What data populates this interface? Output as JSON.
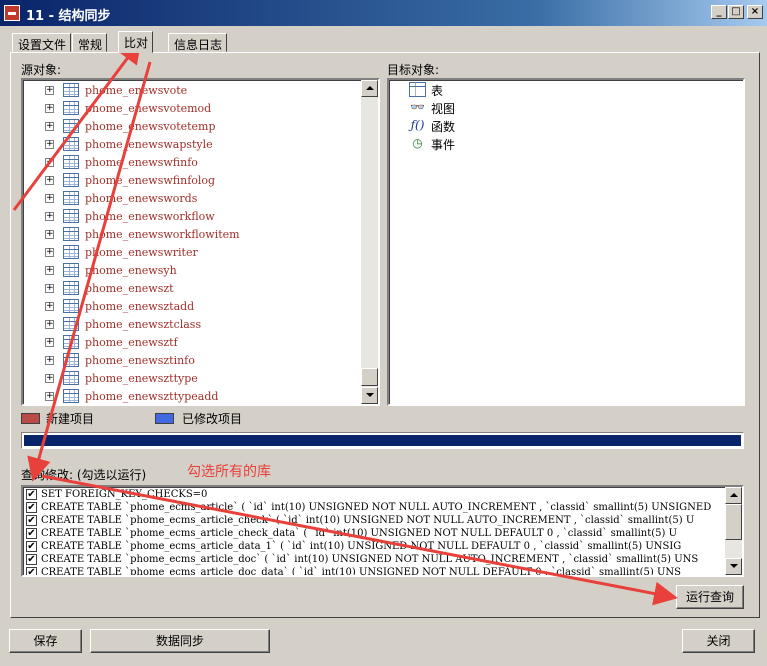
{
  "window": {
    "title": "11 - 结构同步",
    "min_label": "_",
    "max_label": "□",
    "close_label": "×"
  },
  "tabs": [
    {
      "label": "设置文件",
      "active": false
    },
    {
      "label": "常规",
      "active": false
    },
    {
      "label": "比对",
      "active": true
    },
    {
      "label": "信息日志",
      "active": false
    }
  ],
  "source": {
    "label": "源对象:",
    "items": [
      "phome_enewsvote",
      "phome_enewsvotemod",
      "phome_enewsvotetemp",
      "phome_enewswapstyle",
      "phome_enewswfinfo",
      "phome_enewswfinfolog",
      "phome_enewswords",
      "phome_enewsworkflow",
      "phome_enewsworkflowitem",
      "phome_enewswriter",
      "phome_enewsyh",
      "phome_enewszt",
      "phome_enewsztadd",
      "phome_enewsztclass",
      "phome_enewsztf",
      "phome_enewsztinfo",
      "phome_enewszttype",
      "phome_enewszttypeadd"
    ]
  },
  "target": {
    "label": "目标对象:",
    "items": [
      {
        "label": "表",
        "icon": "table-icon"
      },
      {
        "label": "视图",
        "icon": "view-icon"
      },
      {
        "label": "函数",
        "icon": "function-icon"
      },
      {
        "label": "事件",
        "icon": "event-icon"
      }
    ]
  },
  "legend": {
    "new_label": "新建项目",
    "new_color": "#b94a48",
    "modified_label": "已修改项目",
    "modified_color": "#4169e1"
  },
  "progress": {
    "fraction": 1.0,
    "color": "#0a246a"
  },
  "query": {
    "label": "查询修改: (勾选以运行)",
    "annotation": "勾选所有的库",
    "rows": [
      "SET FOREIGN_KEY_CHECKS=0",
      "CREATE TABLE `phome_ecms_article` ( `id` int(10) UNSIGNED NOT NULL AUTO_INCREMENT , `classid` smallint(5) UNSIGNED",
      "CREATE TABLE `phome_ecms_article_check` ( `id` int(10) UNSIGNED NOT NULL AUTO_INCREMENT , `classid` smallint(5) U",
      "CREATE TABLE `phome_ecms_article_check_data` ( `id` int(10) UNSIGNED NOT NULL DEFAULT 0 , `classid` smallint(5) U",
      "CREATE TABLE `phome_ecms_article_data_1` ( `id` int(10) UNSIGNED NOT NULL DEFAULT 0 , `classid` smallint(5) UNSIG",
      "CREATE TABLE `phome_ecms_article_doc` ( `id` int(10) UNSIGNED NOT NULL AUTO_INCREMENT , `classid` smallint(5) UNS",
      "CREATE TABLE `phome_ecms_article_doc_data` ( `id` int(10) UNSIGNED NOT NULL DEFAULT 0 , `classid` smallint(5) UNS"
    ]
  },
  "buttons": {
    "run_query": "运行查询",
    "save": "保存",
    "data_sync": "数据同步",
    "close": "关闭"
  },
  "annotation_color": "#e8403a"
}
